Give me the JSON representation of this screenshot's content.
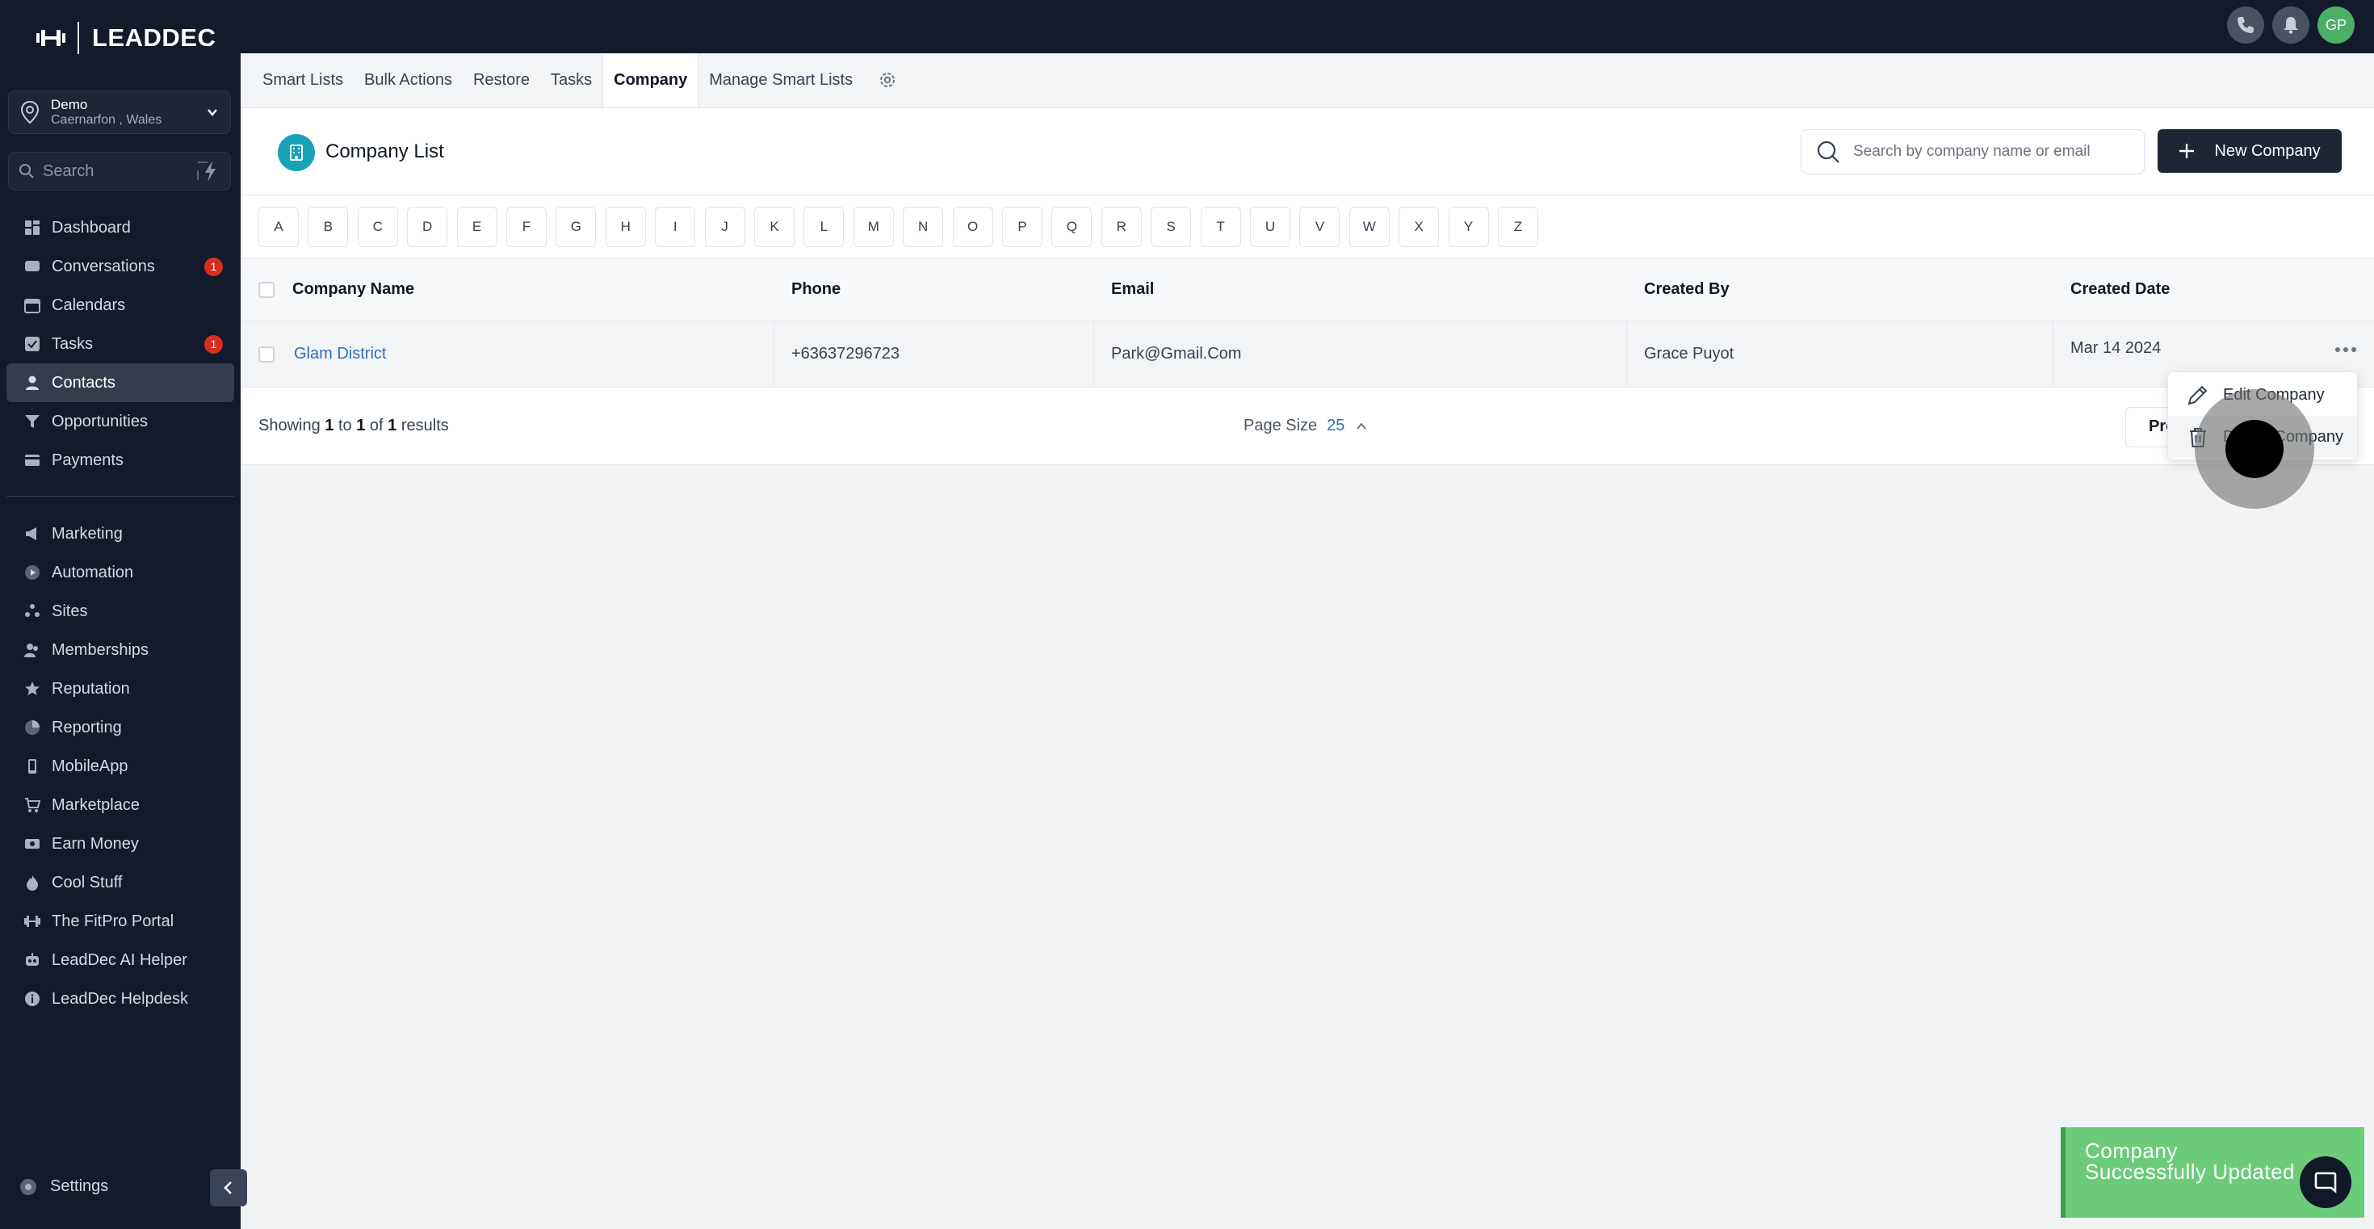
{
  "brand": {
    "logo_text": "LEADDEC"
  },
  "location": {
    "name": "Demo",
    "sub": "Caernarfon , Wales"
  },
  "sidebar_search": {
    "placeholder": "Search"
  },
  "nav_main": [
    {
      "label": "Dashboard",
      "icon": "dashboard-icon"
    },
    {
      "label": "Conversations",
      "icon": "chat-icon",
      "badge": "1"
    },
    {
      "label": "Calendars",
      "icon": "calendar-icon"
    },
    {
      "label": "Tasks",
      "icon": "checkbox-icon",
      "badge": "1"
    },
    {
      "label": "Contacts",
      "icon": "person-icon",
      "active": true
    },
    {
      "label": "Opportunities",
      "icon": "filter-icon"
    },
    {
      "label": "Payments",
      "icon": "card-icon"
    }
  ],
  "nav_secondary": [
    {
      "label": "Marketing",
      "icon": "megaphone-icon"
    },
    {
      "label": "Automation",
      "icon": "play-icon"
    },
    {
      "label": "Sites",
      "icon": "sites-icon"
    },
    {
      "label": "Memberships",
      "icon": "people-icon"
    },
    {
      "label": "Reputation",
      "icon": "star-icon"
    },
    {
      "label": "Reporting",
      "icon": "chart-icon"
    },
    {
      "label": "MobileApp",
      "icon": "phone-icon"
    },
    {
      "label": "Marketplace",
      "icon": "cart-icon"
    },
    {
      "label": "Earn Money",
      "icon": "money-icon"
    },
    {
      "label": "Cool Stuff",
      "icon": "flame-icon"
    },
    {
      "label": "The FitPro Portal",
      "icon": "dumbbell-icon"
    },
    {
      "label": "LeadDec AI Helper",
      "icon": "robot-icon"
    },
    {
      "label": "LeadDec Helpdesk",
      "icon": "info-icon"
    }
  ],
  "settings_label": "Settings",
  "topbar": {
    "avatar_initials": "GP"
  },
  "tabs": [
    {
      "label": "Smart Lists"
    },
    {
      "label": "Bulk Actions"
    },
    {
      "label": "Restore"
    },
    {
      "label": "Tasks"
    },
    {
      "label": "Company",
      "active": true
    },
    {
      "label": "Manage Smart Lists"
    }
  ],
  "page": {
    "title": "Company List",
    "search_placeholder": "Search by company name or email",
    "new_button": "New Company"
  },
  "alphabet": [
    "A",
    "B",
    "C",
    "D",
    "E",
    "F",
    "G",
    "H",
    "I",
    "J",
    "K",
    "L",
    "M",
    "N",
    "O",
    "P",
    "Q",
    "R",
    "S",
    "T",
    "U",
    "V",
    "W",
    "X",
    "Y",
    "Z"
  ],
  "table": {
    "columns": [
      "Company Name",
      "Phone",
      "Email",
      "Created By",
      "Created Date"
    ],
    "rows": [
      {
        "name": "Glam District",
        "phone": "+63637296723",
        "email": "Park@Gmail.Com",
        "created_by": "Grace Puyot",
        "created_date": "Mar 14 2024"
      }
    ]
  },
  "pagination": {
    "showing_prefix": "Showing",
    "from": "1",
    "to_word": "to",
    "to": "1",
    "of_word": "of",
    "total": "1",
    "suffix": "results",
    "page_size_label": "Page Size",
    "page_size": "25",
    "prev_label": "Previous"
  },
  "row_menu": {
    "edit": "Edit Company",
    "delete": "Delete Company"
  },
  "toast": {
    "message": "Company Successfully Updated"
  },
  "colors": {
    "sidebar_bg": "#131a2a",
    "accent_teal": "#17a2b8",
    "link_blue": "#2f6fb5",
    "badge_red": "#d92d20",
    "toast_green": "#6ccb7b"
  }
}
